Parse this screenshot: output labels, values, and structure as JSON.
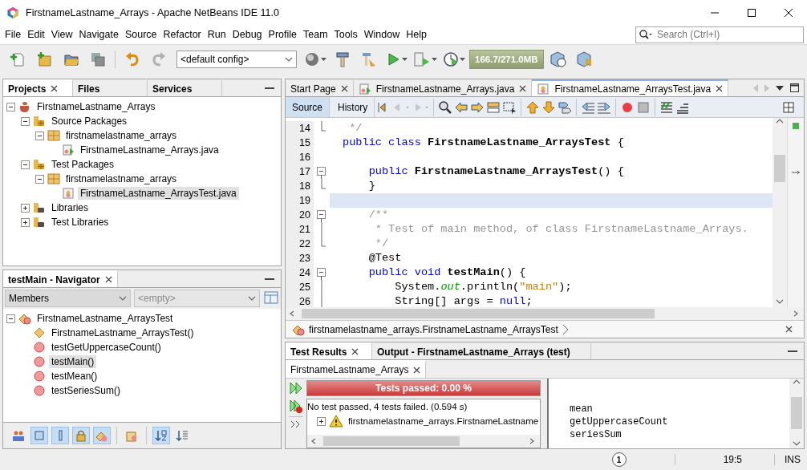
{
  "window": {
    "title": "FirstnameLastname_Arrays - Apache NetBeans IDE 11.0"
  },
  "menu": [
    "File",
    "Edit",
    "View",
    "Navigate",
    "Source",
    "Refactor",
    "Run",
    "Debug",
    "Profile",
    "Team",
    "Tools",
    "Window",
    "Help"
  ],
  "search": {
    "placeholder": "Search (Ctrl+I)"
  },
  "toolbar": {
    "config": "<default config>",
    "memory": "166.7/271.0MB"
  },
  "projects_panel": {
    "tabs": [
      {
        "label": "Projects",
        "selected": true,
        "closable": true
      },
      {
        "label": "Files",
        "selected": false,
        "closable": false
      },
      {
        "label": "Services",
        "selected": false,
        "closable": false
      }
    ],
    "tree": [
      {
        "label": "FirstnameLastname_Arrays",
        "kind": "project",
        "expanded": true,
        "selected": false,
        "children": [
          {
            "label": "Source Packages",
            "kind": "source-folder",
            "expanded": true,
            "selected": false,
            "children": [
              {
                "label": "firstnamelastname_arrays",
                "kind": "package",
                "expanded": true,
                "selected": false,
                "children": [
                  {
                    "label": "FirstnameLastname_Arrays.java",
                    "kind": "java-main",
                    "selected": false
                  }
                ]
              }
            ]
          },
          {
            "label": "Test Packages",
            "kind": "source-folder",
            "expanded": true,
            "selected": false,
            "children": [
              {
                "label": "firstnamelastname_arrays",
                "kind": "package",
                "expanded": true,
                "selected": false,
                "children": [
                  {
                    "label": "FirstnameLastname_ArraysTest.java",
                    "kind": "java-test",
                    "selected": true
                  }
                ]
              }
            ]
          },
          {
            "label": "Libraries",
            "kind": "library",
            "expanded": false,
            "selected": false
          },
          {
            "label": "Test Libraries",
            "kind": "library",
            "expanded": false,
            "selected": false
          }
        ]
      }
    ]
  },
  "navigator": {
    "title": "testMain - Navigator",
    "filter": "Members",
    "scope": {
      "value": "<empty>",
      "disabled": true
    },
    "tree": [
      {
        "label": "FirstnameLastname_ArraysTest",
        "kind": "class",
        "expanded": true,
        "selected": false,
        "children": [
          {
            "label": "FirstnameLastname_ArraysTest()",
            "kind": "constructor",
            "selected": false
          },
          {
            "label": "testGetUppercaseCount()",
            "kind": "method",
            "selected": false
          },
          {
            "label": "testMain()",
            "kind": "method",
            "selected": true
          },
          {
            "label": "testMean()",
            "kind": "method",
            "selected": false
          },
          {
            "label": "testSeriesSum()",
            "kind": "method",
            "selected": false
          }
        ]
      }
    ],
    "filter_buttons": [
      {
        "kind": "inherited",
        "pressed": false
      },
      {
        "kind": "fields",
        "pressed": true
      },
      {
        "kind": "static",
        "pressed": true
      },
      {
        "kind": "private",
        "pressed": true
      },
      {
        "kind": "inner",
        "pressed": true
      },
      {
        "kind": "javadoc",
        "pressed": false
      },
      {
        "kind": "sort-name",
        "pressed": true
      },
      {
        "kind": "sort-source",
        "pressed": false
      }
    ]
  },
  "editor": {
    "tabs": [
      {
        "label": "Start Page",
        "kind": "page",
        "selected": false
      },
      {
        "label": "FirstnameLastname_Arrays.java",
        "kind": "java-main",
        "selected": false
      },
      {
        "label": "FirstnameLastname_ArraysTest.java",
        "kind": "java-test",
        "selected": true
      }
    ],
    "views": [
      {
        "label": "Source",
        "selected": true
      },
      {
        "label": "History",
        "selected": false
      }
    ],
    "lines": [
      {
        "number": "14",
        "kind": "fold-end",
        "highlighted": false,
        "tokens": [
          {
            "text": " */",
            "kind": "comment"
          }
        ]
      },
      {
        "number": "15",
        "kind": "plain",
        "highlighted": false,
        "tokens": [
          {
            "text": "public class ",
            "kind": "keyword"
          },
          {
            "text": "FirstnameLastname_ArraysTest",
            "kind": "name"
          },
          {
            "text": " {",
            "kind": "plain"
          }
        ]
      },
      {
        "number": "16",
        "kind": "plain",
        "highlighted": false
      },
      {
        "number": "17",
        "kind": "fold-start",
        "highlighted": false,
        "tokens": [
          {
            "text": "    public ",
            "kind": "keyword"
          },
          {
            "text": "FirstnameLastname_ArraysTest",
            "kind": "name"
          },
          {
            "text": "() {",
            "kind": "plain"
          }
        ]
      },
      {
        "number": "18",
        "kind": "fold-end",
        "highlighted": false,
        "tokens": [
          {
            "text": "    }",
            "kind": "plain"
          }
        ]
      },
      {
        "number": "19",
        "kind": "plain",
        "highlighted": true
      },
      {
        "number": "20",
        "kind": "fold-start",
        "highlighted": false,
        "tokens": [
          {
            "text": "    /**",
            "kind": "comment"
          }
        ]
      },
      {
        "number": "21",
        "kind": "fold-mid",
        "highlighted": false,
        "tokens": [
          {
            "text": "     * Test of main method, of class FirstnameLastname_Arrays.",
            "kind": "comment"
          }
        ]
      },
      {
        "number": "22",
        "kind": "fold-end",
        "highlighted": false,
        "tokens": [
          {
            "text": "     */",
            "kind": "comment"
          }
        ]
      },
      {
        "number": "23",
        "kind": "plain",
        "highlighted": false,
        "tokens": [
          {
            "text": "    @Test",
            "kind": "plain"
          }
        ]
      },
      {
        "number": "24",
        "kind": "fold-start",
        "highlighted": false,
        "tokens": [
          {
            "text": "    public void ",
            "kind": "keyword"
          },
          {
            "text": "testMain",
            "kind": "name"
          },
          {
            "text": "() {",
            "kind": "plain"
          }
        ]
      },
      {
        "number": "25",
        "kind": "fold-mid",
        "highlighted": false,
        "tokens": [
          {
            "text": "        System.",
            "kind": "plain"
          },
          {
            "text": "out",
            "kind": "field"
          },
          {
            "text": ".println(",
            "kind": "plain"
          },
          {
            "text": "\"main\"",
            "kind": "string"
          },
          {
            "text": ");",
            "kind": "plain"
          }
        ]
      },
      {
        "number": "26",
        "kind": "fold-mid",
        "highlighted": false,
        "tokens": [
          {
            "text": "        String[] args = ",
            "kind": "plain"
          },
          {
            "text": "null",
            "kind": "keyword"
          },
          {
            "text": ";",
            "kind": "plain"
          }
        ]
      }
    ],
    "breadcrumb": "firstnamelastname_arrays.FirstnameLastname_ArraysTest"
  },
  "output": {
    "tabs": [
      {
        "label": "Test Results",
        "selected": true,
        "closable": true
      },
      {
        "label": "Output - FirstnameLastname_Arrays (test)",
        "selected": false,
        "closable": false
      }
    ],
    "session_tab": "FirstnameLastname_Arrays",
    "progress": {
      "label": "Tests passed: 0.00 %",
      "kind": "failed"
    },
    "summary": "No test passed, 4 tests failed. (0.594 s)",
    "results": [
      {
        "label": "firstnamelastname_arrays.FirstnameLastname",
        "kind": "warning",
        "expanded": false
      }
    ],
    "console": [
      "mean",
      "getUppercaseCount",
      "seriesSum"
    ]
  },
  "status_bar": {
    "notifications": "1",
    "position": "19:5",
    "mode": "INS"
  }
}
